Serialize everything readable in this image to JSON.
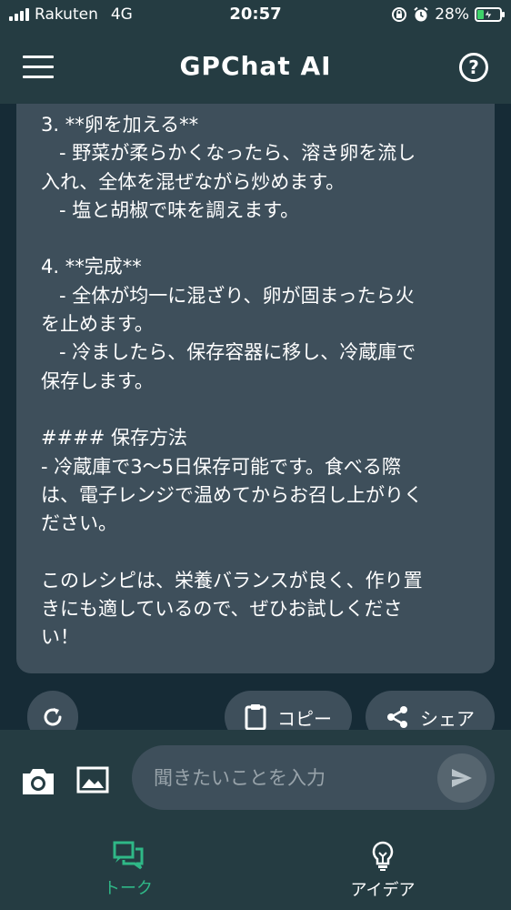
{
  "status_bar": {
    "carrier": "Rakuten",
    "network": "4G",
    "time": "20:57",
    "battery": "28%",
    "battery_level": 0.28
  },
  "header": {
    "title": "GPChat AI"
  },
  "message": {
    "text": "3. **卵を加える**\n   - 野菜が柔らかくなったら、溶き卵を流し\n入れ、全体を混ぜながら炒めます。\n   - 塩と胡椒で味を調えます。\n\n4. **完成**\n   - 全体が均一に混ざり、卵が固まったら火\nを止めます。\n   - 冷ましたら、保存容器に移し、冷蔵庫で\n保存します。\n\n#### 保存方法\n- 冷蔵庫で3〜5日保存可能です。食べる際\nは、電子レンジで温めてからお召し上がりく\nださい。\n\nこのレシピは、栄養バランスが良く、作り置\nきにも適しているので、ぜひお試しくださ\nい！"
  },
  "actions": {
    "copy_label": "コピー",
    "share_label": "シェア"
  },
  "input": {
    "placeholder": "聞きたいことを入力",
    "value": ""
  },
  "nav": {
    "talk_label": "トーク",
    "idea_label": "アイデア"
  },
  "colors": {
    "accent": "#2fb887",
    "battery_green": "#3ed36a",
    "bubble": "#3e4f5b",
    "background": "#253c42",
    "chat_bg": "#162b36"
  },
  "icons": {
    "menu": "hamburger-menu-icon",
    "help": "question-circle-icon",
    "refresh": "refresh-icon",
    "copy": "clipboard-icon",
    "share": "share-icon",
    "camera": "camera-icon",
    "image": "image-icon",
    "send": "send-icon",
    "talk": "chat-bubbles-icon",
    "idea": "lightbulb-icon"
  }
}
